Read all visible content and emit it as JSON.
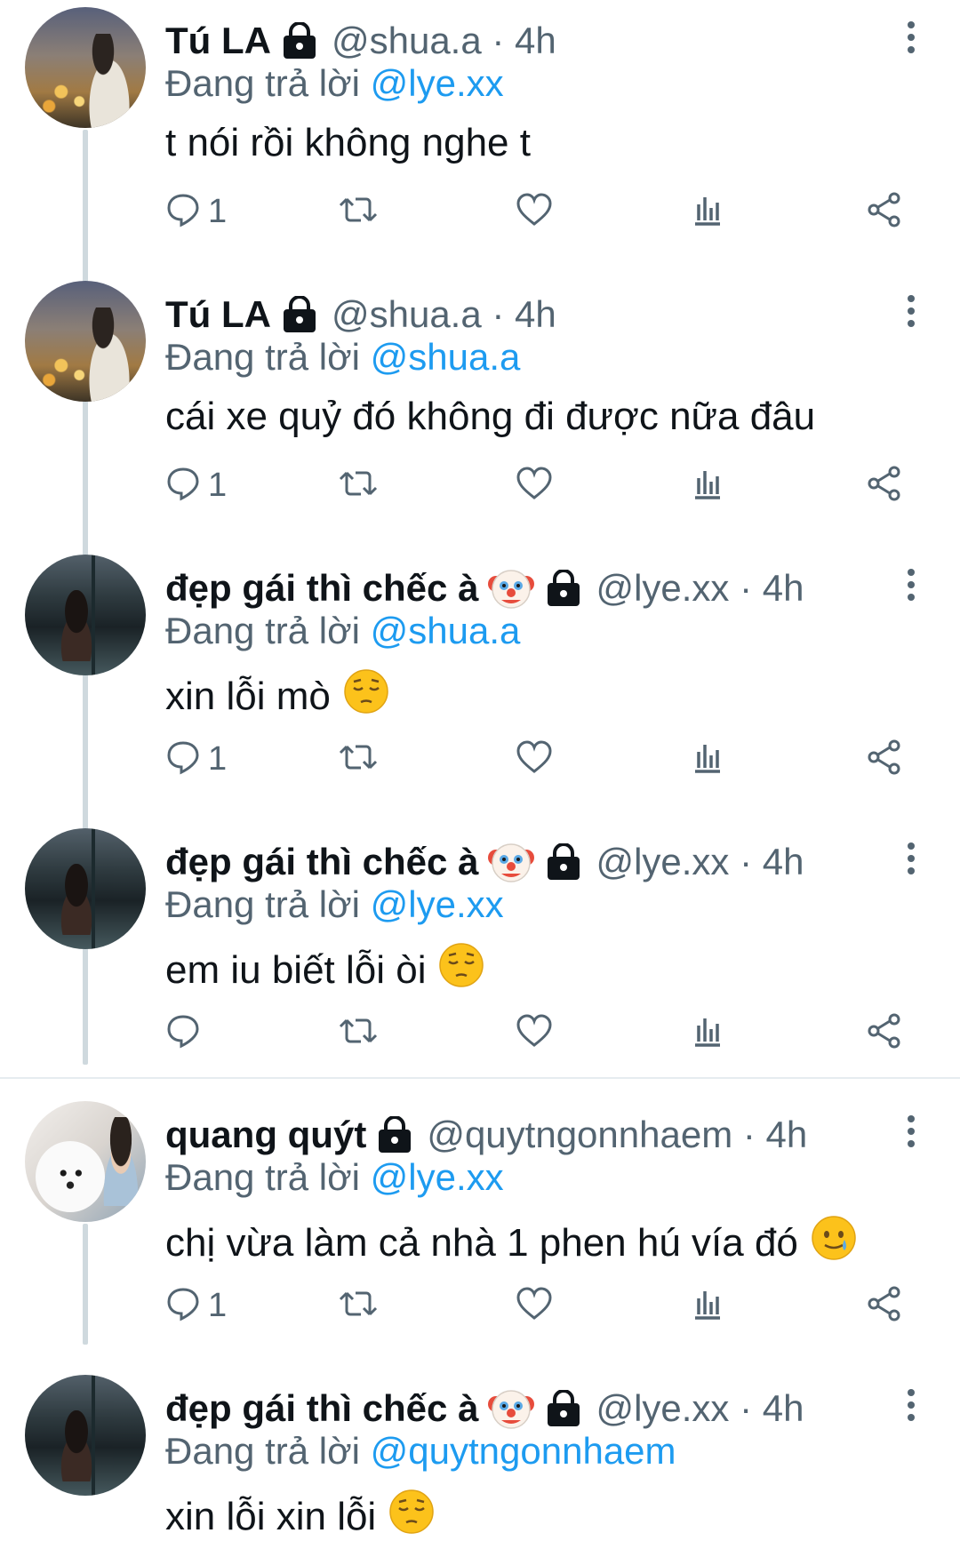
{
  "colors": {
    "accent": "#1d9bf0",
    "secondary_text": "#536471",
    "thread_line": "#cfd9de"
  },
  "tweets": [
    {
      "name": "Tú LA",
      "handle": "@shua.a · 4h",
      "reply_prefix": "Đang trả lời ",
      "reply_to": "@lye.xx",
      "text": "t nói rồi không nghe t",
      "reply_count": "1",
      "avatar": "city-night-boy",
      "emoji": ""
    },
    {
      "name": "Tú LA",
      "handle": "@shua.a · 4h",
      "reply_prefix": "Đang trả lời ",
      "reply_to": "@shua.a",
      "text": "cái xe quỷ đó không đi được nữa đâu",
      "reply_count": "1",
      "avatar": "city-night-boy",
      "emoji": ""
    },
    {
      "name": "đẹp gái thì chếc à",
      "handle": "@lye.xx · 4h",
      "reply_prefix": "Đang trả lời ",
      "reply_to": "@shua.a",
      "text": "xin lỗi mò",
      "reply_count": "1",
      "avatar": "dark-room-girl",
      "emoji": "pensive-face"
    },
    {
      "name": "đẹp gái thì chếc à",
      "handle": "@lye.xx · 4h",
      "reply_prefix": "Đang trả lời ",
      "reply_to": "@lye.xx",
      "text": "em iu biết lỗi òi",
      "reply_count": "",
      "avatar": "dark-room-girl",
      "emoji": "pensive-face"
    },
    {
      "name": "quang quýt",
      "handle": "@quytngonnhaem · 4h",
      "reply_prefix": "Đang trả lời ",
      "reply_to": "@lye.xx",
      "text": "chị vừa làm cả nhà 1 phen hú vía đó",
      "reply_count": "1",
      "avatar": "boy-with-dog",
      "emoji": "smiling-face-with-tear"
    },
    {
      "name": "đẹp gái thì chếc à",
      "handle": "@lye.xx · 4h",
      "reply_prefix": "Đang trả lời ",
      "reply_to": "@quytngonnhaem",
      "text": "xin lỗi xin lỗi",
      "reply_count": "",
      "avatar": "dark-room-girl",
      "emoji": "pensive-face"
    }
  ]
}
